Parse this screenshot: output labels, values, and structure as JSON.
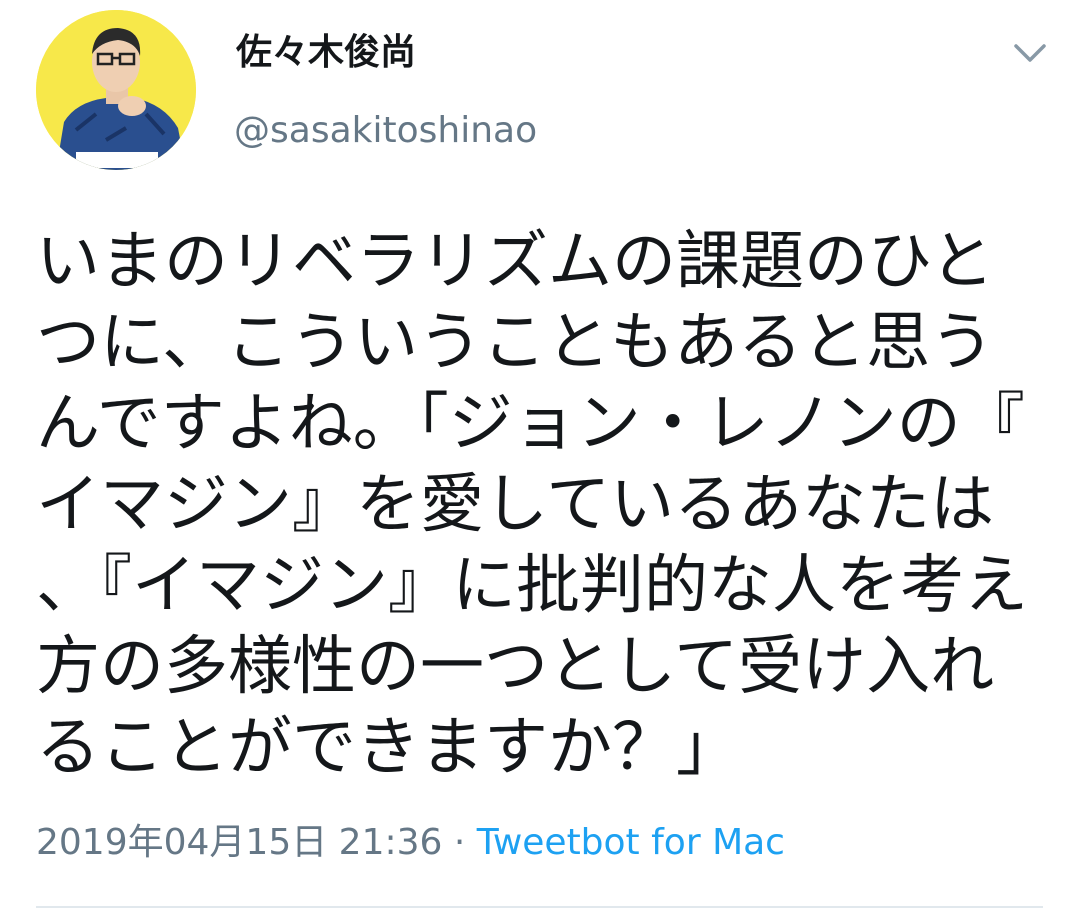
{
  "user": {
    "display_name": "佐々木俊尚",
    "handle": "@sasakitoshinao",
    "avatar_caption": "toshinao"
  },
  "icons": {
    "menu": "chevron-down-icon"
  },
  "tweet": {
    "text": "いまのリベラリズムの課題のひとつに、こういうこともあると思うんですよね。「ジョン・レノンの『イマジン』を愛しているあなたは、『イマジン』に批判的な人を考え方の多様性の一つとして受け入れることができますか？」",
    "timestamp": "2019年04月15日 21:36",
    "separator": "·",
    "source": "Tweetbot for Mac"
  },
  "colors": {
    "text_primary": "#14171a",
    "text_secondary": "#657786",
    "link": "#1da1f2",
    "avatar_bg": "#f7e84a",
    "divider": "#e1e8ed"
  }
}
